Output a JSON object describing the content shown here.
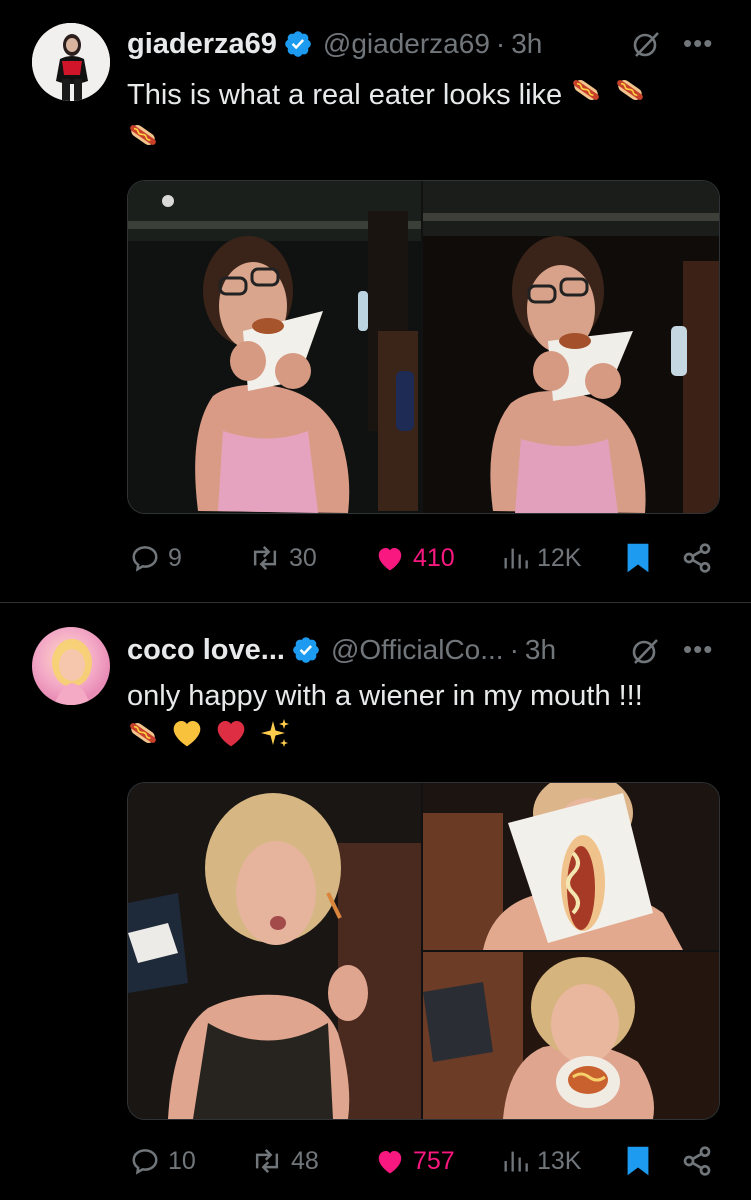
{
  "tweets": [
    {
      "display_name": "giaderza69",
      "handle": "@giaderza69",
      "separator": "·",
      "time": "3h",
      "text": "This is what a real eater looks like",
      "emojis": [
        "hotdog-emoji",
        "hotdog-emoji",
        "hotdog-emoji"
      ],
      "stats": {
        "replies": "9",
        "reposts": "30",
        "likes": "410",
        "views": "12K"
      },
      "media": [
        "photo-1",
        "photo-2"
      ]
    },
    {
      "display_name": "coco love...",
      "handle": "@OfficialCo...",
      "separator": "·",
      "time": "3h",
      "text": "only happy with a wiener in my mouth !!!",
      "emojis": [
        "hotdog-emoji",
        "yellow-heart-emoji",
        "red-heart-emoji",
        "sparkles-emoji"
      ],
      "stats": {
        "replies": "10",
        "reposts": "48",
        "likes": "757",
        "views": "13K"
      },
      "media": [
        "photo-1",
        "photo-2",
        "photo-3"
      ]
    }
  ],
  "colors": {
    "background": "#000000",
    "text": "#e7e9ea",
    "secondary": "#71767b",
    "verified": "#1d9bf0",
    "like": "#f91880",
    "bookmark": "#1d9bf0",
    "divider": "#2f3336"
  },
  "icons": [
    "verified-badge-icon",
    "grok-icon",
    "more-icon",
    "reply-icon",
    "repost-icon",
    "like-icon",
    "views-icon",
    "bookmark-icon",
    "share-icon"
  ]
}
